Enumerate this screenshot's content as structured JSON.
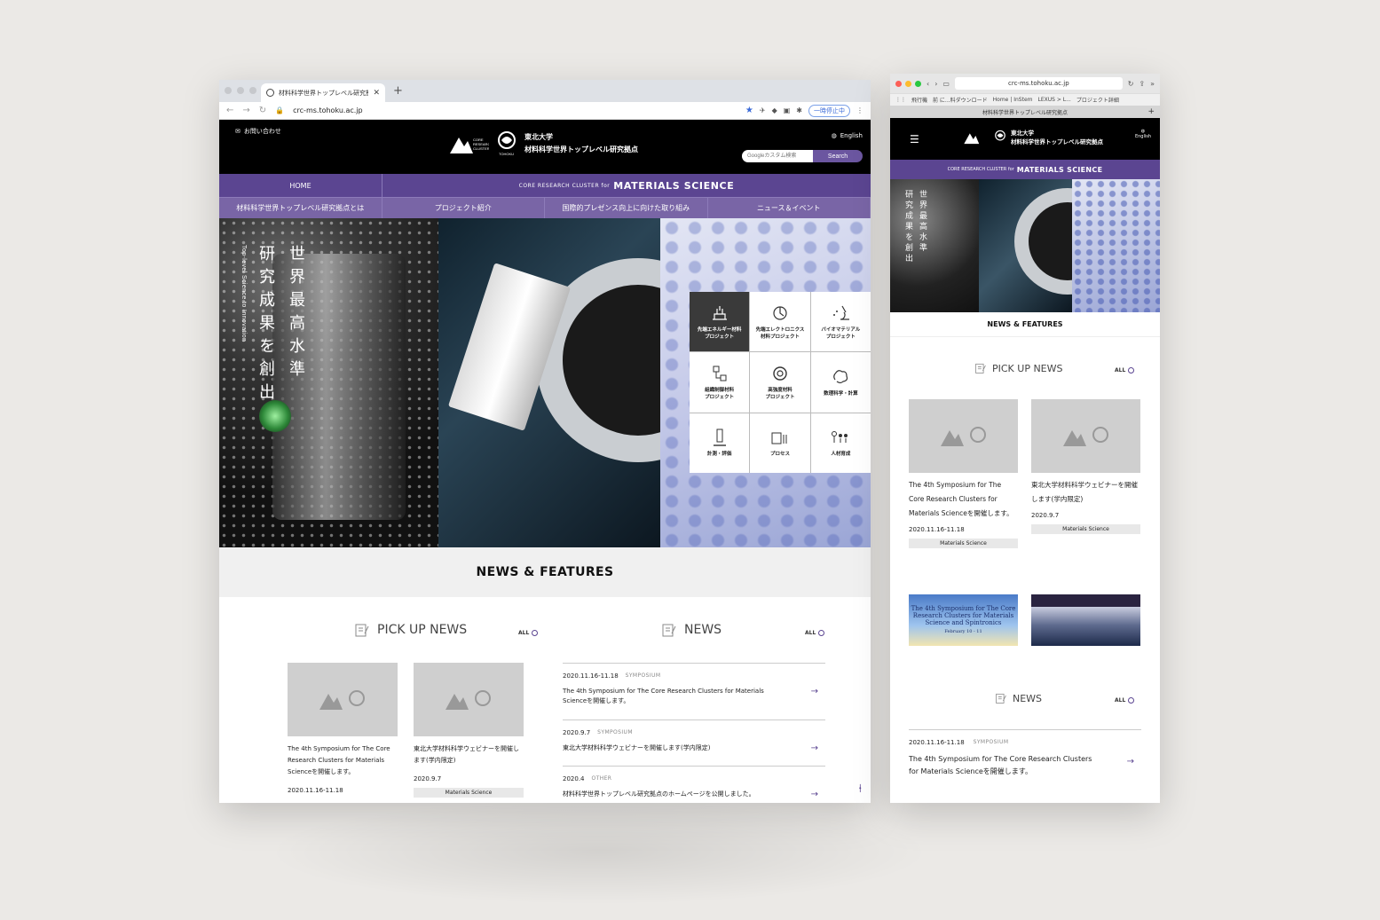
{
  "desktop": {
    "tab_title": "材料科学世界トップレベル研究拠点",
    "url": "crc-ms.tohoku.ac.jp",
    "pause_label": "一時停止中",
    "header": {
      "contact": "お問い合わせ",
      "uni": "東北大学",
      "site_name": "材料科学世界トップレベル研究拠点",
      "lang": "English",
      "search_placeholder": "Googleカスタム検索",
      "search_button": "Search"
    },
    "nav": {
      "home": "HOME",
      "crc_small": "CORE RESEARCH CLUSTER for",
      "crc_big": "MATERIALS SCIENCE",
      "items": [
        "材料科学世界トップレベル研究拠点とは",
        "プロジェクト紹介",
        "国際的プレゼンス向上に向けた取り組み",
        "ニュース＆イベント"
      ]
    },
    "hero": {
      "line1": "世界最高水準",
      "line2": "研究成果を創出",
      "sub": "Top-level Science to Innovation"
    },
    "projects": [
      {
        "label": "先端エネルギー材料\nプロジェクト",
        "icon": "energy-icon"
      },
      {
        "label": "先端エレクトロニクス\n材料プロジェクト",
        "icon": "electronics-icon"
      },
      {
        "label": "バイオマテリアル\nプロジェクト",
        "icon": "microscope-icon"
      },
      {
        "label": "組織制御材料\nプロジェクト",
        "icon": "structure-icon"
      },
      {
        "label": "高強度材料\nプロジェクト",
        "icon": "gear-icon"
      },
      {
        "label": "数理科学・計算",
        "icon": "brain-icon"
      },
      {
        "label": "計測・評価",
        "icon": "measure-icon"
      },
      {
        "label": "プロセス",
        "icon": "process-icon"
      },
      {
        "label": "人材育成",
        "icon": "people-icon"
      }
    ],
    "news_features": "NEWS & FEATURES",
    "pickup_title": "PICK UP NEWS",
    "news_title": "NEWS",
    "all_label": "ALL",
    "pickup": [
      {
        "title": "The 4th Symposium for The Core Research Clusters for Materials Scienceを開催します。",
        "date": "2020.11.16-11.18"
      },
      {
        "title": "東北大学材料科学ウェビナーを開催します(学内限定)",
        "date": "2020.9.7",
        "tag": "Materials Science"
      }
    ],
    "news": [
      {
        "date": "2020.11.16-11.18",
        "cat": "SYMPOSIUM",
        "text": "The 4th Symposium for The Core Research Clusters for Materials Scienceを開催します。"
      },
      {
        "date": "2020.9.7",
        "cat": "SYMPOSIUM",
        "text": "東北大学材料科学ウェビナーを開催します(学内限定)"
      },
      {
        "date": "2020.4",
        "cat": "OTHER",
        "text": "材料科学世界トップレベル研究拠点のホームページを公開しました。"
      }
    ]
  },
  "mobile": {
    "url": "crc-ms.tohoku.ac.jp",
    "bookmarks": [
      "飛行機",
      "前 に...料ダウンロード",
      "Home | InStem",
      "LEXUS > L...",
      "プロジェクト詳細"
    ],
    "tab_title": "材料科学世界トップレベル研究拠点",
    "uni": "東北大学",
    "site_name": "材料科学世界トップレベル研究拠点",
    "lang": "English",
    "crc_small": "CORE RESEARCH CLUSTER for",
    "crc_big": "MATERIALS SCIENCE",
    "hero_line1": "世界最高水準",
    "hero_line2": "研究成果を創出",
    "news_features": "NEWS & FEATURES",
    "pickup_title": "PICK UP NEWS",
    "news_title": "NEWS",
    "all_label": "ALL",
    "pickup": [
      {
        "title": "The 4th Symposium for The Core Research Clusters for Materials Scienceを開催します。",
        "date": "2020.11.16-11.18",
        "tag": "Materials Science"
      },
      {
        "title": "東北大学材料科学ウェビナーを開催します(学内限定)",
        "date": "2020.9.7",
        "tag": "Materials Science"
      }
    ],
    "banner1_text": "The 4th Symposium for The Core Research Clusters for Materials Science and Spintronics",
    "banner1_date": "February 10 - 11",
    "news": [
      {
        "date": "2020.11.16-11.18",
        "cat": "SYMPOSIUM",
        "text": "The 4th Symposium for The Core Research Clusters for Materials Scienceを開催します。"
      }
    ]
  },
  "colors": {
    "purple": "#5b4591",
    "purple_light": "#7965a6"
  }
}
